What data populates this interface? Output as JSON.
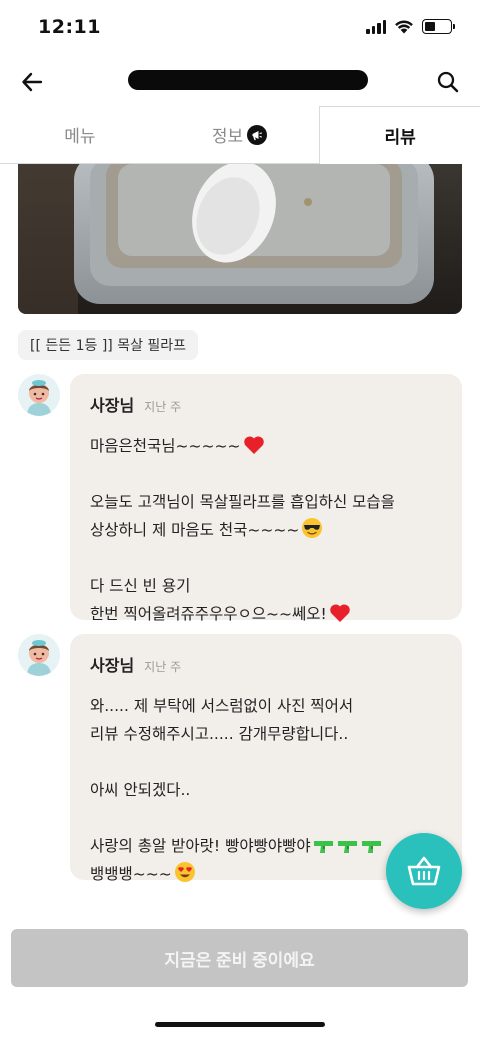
{
  "status_bar": {
    "time": "12:11"
  },
  "header": {
    "back_icon": "arrow-left-icon",
    "search_icon": "search-icon"
  },
  "tabs": [
    {
      "label": "메뉴"
    },
    {
      "label": "정보"
    },
    {
      "label": "리뷰"
    }
  ],
  "review": {
    "menu_tag": "[[ 든든 1등 ]]  목살 필라프"
  },
  "replies": [
    {
      "author": "사장님",
      "time": "지난 주",
      "lines": [
        "마음은천국님~~~~~",
        "",
        "오늘도 고객님이 목살필라프를 흡입하신 모습을",
        "상상하니 제 마음도 천국~~~~",
        "",
        "다 드신 빈 용기",
        "한번 찍어올려쥬주우우ㅇ으~~쎄오!"
      ]
    },
    {
      "author": "사장님",
      "time": "지난 주",
      "lines": [
        "와..... 제 부탁에 서스럼없이 사진 찍어서",
        "리뷰 수정해주시고..... 감개무량합니다..",
        "",
        "아씨 안되겠다..",
        "",
        "사랑의 총알 받아랏! 빵야빵야빵야",
        "뱅뱅뱅~~~"
      ]
    }
  ],
  "cart": {
    "icon": "shopping-basket-icon"
  },
  "order_button": {
    "label": "지금은 준비 중이에요"
  },
  "colors": {
    "accent": "#2ac1bc",
    "bubble": "#f2efea",
    "disabled": "#c4c4c4"
  }
}
